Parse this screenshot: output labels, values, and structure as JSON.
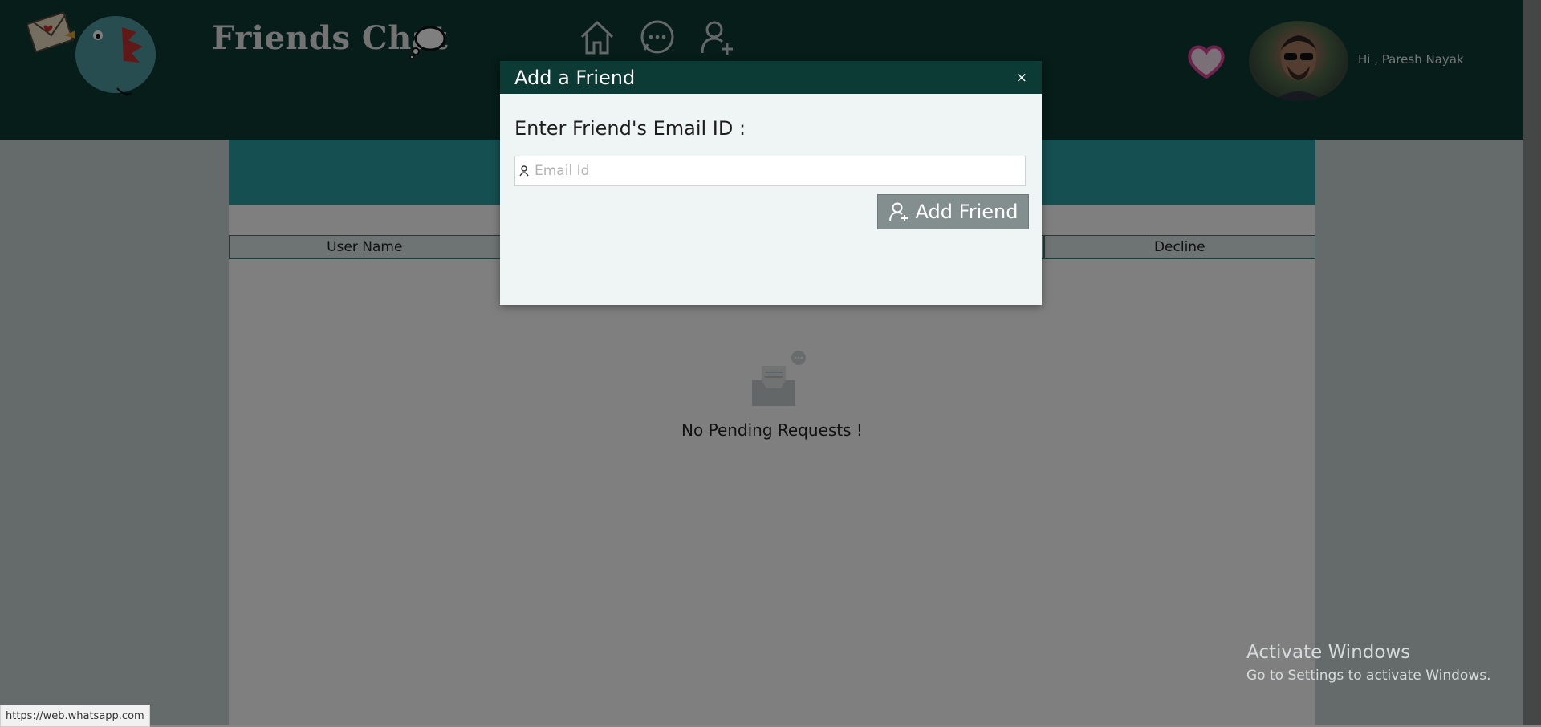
{
  "header": {
    "brand": "Friends Chat",
    "greeting": "Hi , Paresh Nayak",
    "nav": [
      "home-icon",
      "chat-icon",
      "add-user-icon"
    ]
  },
  "page": {
    "columns": [
      "User Name",
      "",
      "",
      "Decline"
    ],
    "empty_message": "No Pending Requests !"
  },
  "modal": {
    "title": "Add a Friend",
    "close": "×",
    "label": "Enter Friend's Email ID :",
    "input_placeholder": "Email Id",
    "input_value": "",
    "button_label": "Add Friend"
  },
  "os": {
    "activate_title": "Activate Windows",
    "activate_sub": "Go to Settings to activate Windows.",
    "status_url": "https://web.whatsapp.com"
  },
  "colors": {
    "header_bg": "#0c3a34",
    "banner": "#2c9fa2",
    "modal_bg": "#eff5f4",
    "button_bg": "#838f8e",
    "heart": "#e0449b"
  }
}
